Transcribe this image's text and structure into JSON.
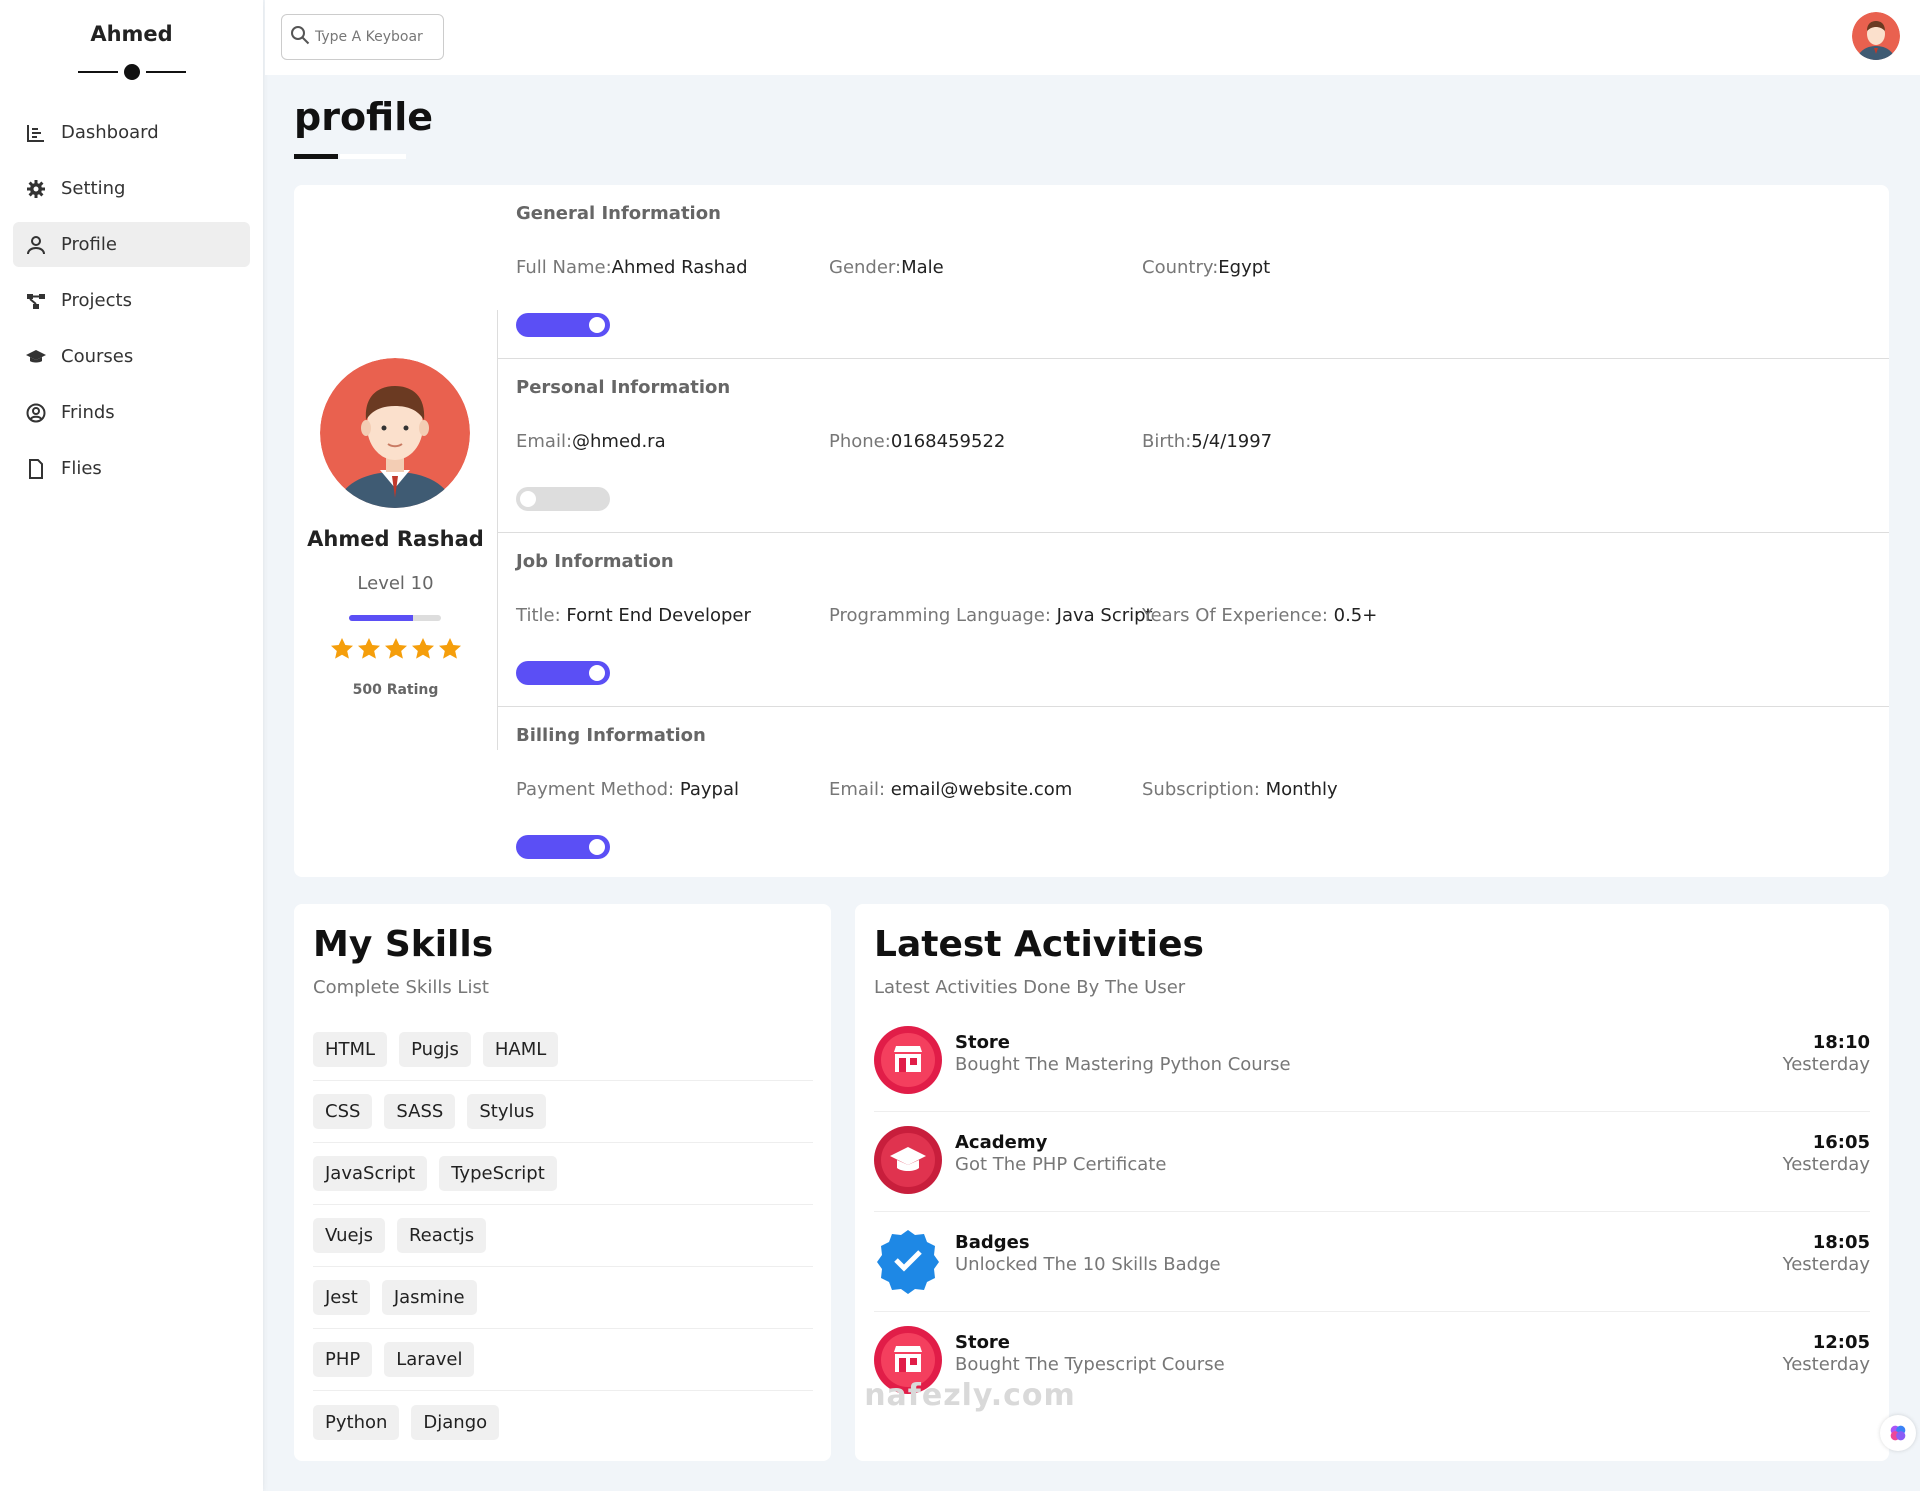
{
  "sidebar": {
    "brand": "Ahmed",
    "items": [
      {
        "label": "Dashboard",
        "icon": "chart-icon"
      },
      {
        "label": "Setting",
        "icon": "gear-icon"
      },
      {
        "label": "Profile",
        "icon": "user-icon"
      },
      {
        "label": "Projects",
        "icon": "diagram-icon"
      },
      {
        "label": "Courses",
        "icon": "graduation-cap-icon"
      },
      {
        "label": "Frinds",
        "icon": "user-circle-icon"
      },
      {
        "label": "Flies",
        "icon": "file-icon"
      }
    ],
    "active": "Profile"
  },
  "topbar": {
    "search_placeholder": "Type A Keyboar"
  },
  "page_title": "profile",
  "profile": {
    "name": "Ahmed Rashad",
    "level": "Level 10",
    "level_progress": 0.7,
    "stars": 5,
    "rating": "500 Rating",
    "sections": [
      {
        "title": "General Information",
        "fields": [
          {
            "label": "Full Name:",
            "value": "Ahmed Rashad"
          },
          {
            "label": "Gender:",
            "value": "Male"
          },
          {
            "label": "Country:",
            "value": "Egypt"
          }
        ],
        "toggle_on": true
      },
      {
        "title": "Personal Information",
        "fields": [
          {
            "label": "Email:",
            "value": "@hmed.ra"
          },
          {
            "label": "Phone:",
            "value": "0168459522"
          },
          {
            "label": "Birth:",
            "value": "5/4/1997"
          }
        ],
        "toggle_on": false
      },
      {
        "title": "Job Information",
        "fields": [
          {
            "label": "Title:",
            "value": " Fornt End Developer"
          },
          {
            "label": "Programming Language:",
            "value": " Java Script"
          },
          {
            "label": "Years Of Experience:",
            "value": " 0.5+"
          }
        ],
        "toggle_on": true
      },
      {
        "title": "Billing Information",
        "fields": [
          {
            "label": "Payment Method:",
            "value": " Paypal"
          },
          {
            "label": "Email:",
            "value": " email@website.com"
          },
          {
            "label": "Subscription:",
            "value": " Monthly"
          }
        ],
        "toggle_on": true
      }
    ]
  },
  "skills": {
    "title": "My Skills",
    "subtitle": "Complete Skills List",
    "rows": [
      [
        "HTML",
        "Pugjs",
        "HAML"
      ],
      [
        "CSS",
        "SASS",
        "Stylus"
      ],
      [
        "JavaScript",
        "TypeScript"
      ],
      [
        "Vuejs",
        "Reactjs"
      ],
      [
        "Jest",
        "Jasmine"
      ],
      [
        "PHP",
        "Laravel"
      ],
      [
        "Python",
        "Django"
      ]
    ]
  },
  "activities": {
    "title": "Latest Activities",
    "subtitle": "Latest Activities Done By The User",
    "items": [
      {
        "title": "Store",
        "desc": "Bought The Mastering Python Course",
        "time": "18:10",
        "day": "Yesterday",
        "icon": "store-icon"
      },
      {
        "title": "Academy",
        "desc": "Got The PHP Certificate",
        "time": "16:05",
        "day": "Yesterday",
        "icon": "academy-icon"
      },
      {
        "title": "Badges",
        "desc": "Unlocked The 10 Skills Badge",
        "time": "18:05",
        "day": "Yesterday",
        "icon": "badge-check-icon"
      },
      {
        "title": "Store",
        "desc": "Bought The Typescript Course",
        "time": "12:05",
        "day": "Yesterday",
        "icon": "store-icon"
      }
    ]
  },
  "watermark": "nafezly.com",
  "colors": {
    "accent": "#5b4ff5",
    "star": "#f59e0b",
    "store": "#e11d48",
    "badge": "#1e88e5"
  }
}
